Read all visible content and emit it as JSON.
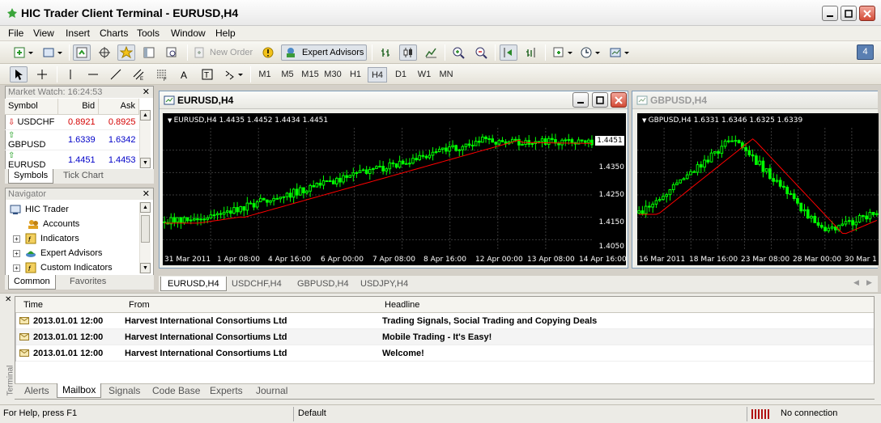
{
  "window": {
    "title": "HIC Trader Client Terminal - EURUSD,H4"
  },
  "menu": [
    "File",
    "View",
    "Insert",
    "Charts",
    "Tools",
    "Window",
    "Help"
  ],
  "toolbar": {
    "new_order": "New Order",
    "expert_advisors": "Expert Advisors",
    "alert_count": "4"
  },
  "timeframes": [
    "M1",
    "M5",
    "M15",
    "M30",
    "H1",
    "H4",
    "D1",
    "W1",
    "MN"
  ],
  "active_timeframe": "H4",
  "market_watch": {
    "title": "Market Watch: 16:24:53",
    "columns": [
      "Symbol",
      "Bid",
      "Ask"
    ],
    "rows": [
      {
        "symbol": "USDCHF",
        "bid": "0.8921",
        "ask": "0.8925",
        "dir": "down"
      },
      {
        "symbol": "GBPUSD",
        "bid": "1.6339",
        "ask": "1.6342",
        "dir": "up"
      },
      {
        "symbol": "EURUSD",
        "bid": "1.4451",
        "ask": "1.4453",
        "dir": "up"
      }
    ],
    "tabs": [
      "Symbols",
      "Tick Chart"
    ]
  },
  "navigator": {
    "title": "Navigator",
    "items": [
      "HIC Trader",
      "Accounts",
      "Indicators",
      "Expert Advisors",
      "Custom Indicators"
    ],
    "tabs": [
      "Common",
      "Favorites"
    ]
  },
  "chart_eurusd": {
    "title": "EURUSD,H4",
    "ohlc": "EURUSD,H4  1.4435 1.4452 1.4434 1.4451",
    "price_labels": [
      "1.4350",
      "1.4250",
      "1.4150",
      "1.4050"
    ],
    "current_price": "1.4451",
    "time_labels": [
      "31 Mar 2011",
      "1 Apr 08:00",
      "4 Apr 16:00",
      "6 Apr 00:00",
      "7 Apr 08:00",
      "8 Apr 16:00",
      "12 Apr 00:00",
      "13 Apr 08:00",
      "14 Apr 16:00"
    ]
  },
  "chart_gbpusd": {
    "title": "GBPUSD,H4",
    "ohlc": "GBPUSD,H4  1.6331 1.6346 1.6325 1.6339",
    "time_labels": [
      "16 Mar 2011",
      "18 Mar 16:00",
      "23 Mar 08:00",
      "28 Mar 00:00",
      "30 Mar 1"
    ]
  },
  "chart_tabs": [
    "EURUSD,H4",
    "USDCHF,H4",
    "GBPUSD,H4",
    "USDJPY,H4"
  ],
  "terminal": {
    "label": "Terminal",
    "columns": [
      "Time",
      "From",
      "Headline"
    ],
    "rows": [
      {
        "time": "2013.01.01 12:00",
        "from": "Harvest International Consortiums Ltd",
        "headline": "Trading Signals, Social Trading and Copying Deals"
      },
      {
        "time": "2013.01.01 12:00",
        "from": "Harvest International Consortiums Ltd",
        "headline": "Mobile Trading - It's Easy!"
      },
      {
        "time": "2013.01.01 12:00",
        "from": "Harvest International Consortiums Ltd",
        "headline": "Welcome!"
      }
    ],
    "tabs": [
      "Alerts",
      "Mailbox",
      "Signals",
      "Code Base",
      "Experts",
      "Journal"
    ],
    "active_tab": "Mailbox"
  },
  "status": {
    "help": "For Help, press F1",
    "profile": "Default",
    "connection": "No connection"
  },
  "colors": {
    "bull": "#00ff00",
    "bear": "#00ff00",
    "ma": "#ff0000",
    "bid_down": "#d40000",
    "bid_up": "#0000c8"
  }
}
